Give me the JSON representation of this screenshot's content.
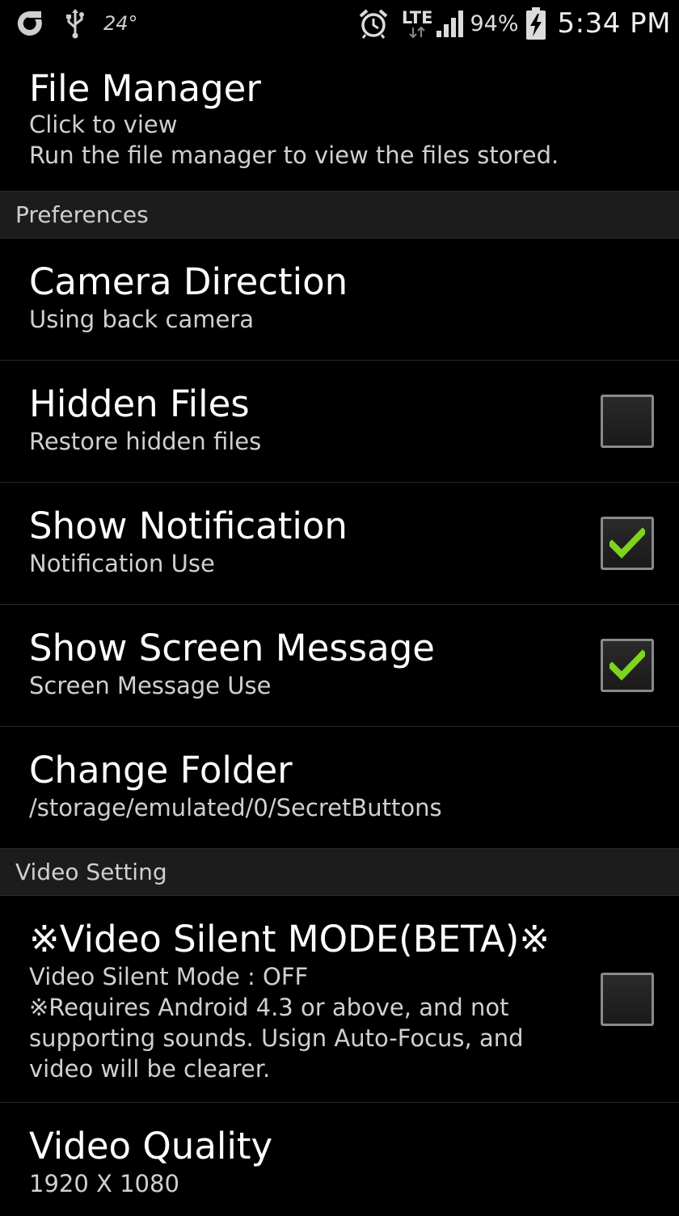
{
  "status_bar": {
    "temperature": "24°",
    "network": "LTE",
    "battery_percent": "94%",
    "time": "5:34 PM",
    "icons": [
      "app-notification-icon",
      "usb-icon",
      "alarm-icon",
      "lte-icon",
      "signal-icon",
      "battery-charging-icon"
    ]
  },
  "file_manager": {
    "title": "File Manager",
    "summary": "Click to view\nRun the file manager to view the files stored."
  },
  "sections": {
    "preferences": "Preferences",
    "video_setting": "Video Setting"
  },
  "preferences": [
    {
      "title": "Camera Direction",
      "summary": "Using back camera"
    },
    {
      "title": "Hidden Files",
      "summary": "Restore hidden files",
      "checked": false
    },
    {
      "title": "Show Notification",
      "summary": "Notification Use",
      "checked": true
    },
    {
      "title": "Show Screen Message",
      "summary": "Screen Message Use",
      "checked": true
    },
    {
      "title": "Change Folder",
      "summary": "/storage/emulated/0/SecretButtons"
    }
  ],
  "video": [
    {
      "title": "※Video Silent MODE(BETA)※",
      "summary": "Video Silent Mode : OFF\n※Requires Android 4.3 or above, and not\nsupporting sounds. Usign Auto-Focus, and\nvideo will be clearer.",
      "checked": false
    },
    {
      "title": "Video Quality",
      "summary": "1920 X 1080"
    }
  ],
  "colors": {
    "background": "#000000",
    "section_header_bg": "#1c1c1c",
    "check_green": "#7ed321",
    "divider": "#2a2a2a"
  }
}
